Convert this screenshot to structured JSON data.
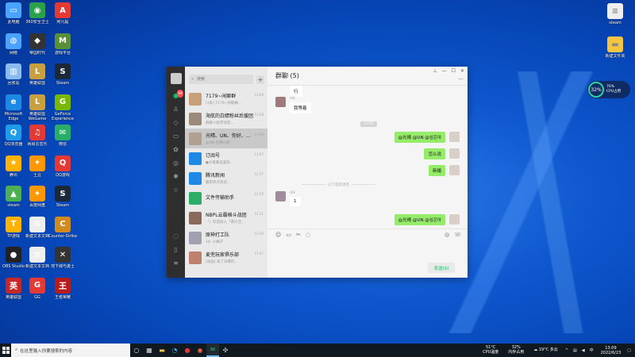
{
  "desktop_icons_left": [
    {
      "label": "此电脑",
      "color": "#4aa3ff",
      "glyph": "▭"
    },
    {
      "label": "360安全卫士",
      "color": "#2aa04a",
      "glyph": "◉"
    },
    {
      "label": "阿凡提",
      "color": "#e53935",
      "glyph": "A"
    },
    {
      "label": "网络",
      "color": "#4aa3ff",
      "glyph": "◍"
    },
    {
      "label": "帝国时代",
      "color": "#333333",
      "glyph": "◆"
    },
    {
      "label": "游戏平台",
      "color": "#5a8f3a",
      "glyph": "M"
    },
    {
      "label": "回收站",
      "color": "#88bbee",
      "glyph": "▥"
    },
    {
      "label": "英雄联盟",
      "color": "#c8a040",
      "glyph": "L"
    },
    {
      "label": "Steam",
      "color": "#1b2838",
      "glyph": "S"
    },
    {
      "label": "Microsoft Edge",
      "color": "#1e88e5",
      "glyph": "e"
    },
    {
      "label": "英雄联盟WeGame",
      "color": "#c8a040",
      "glyph": "L"
    },
    {
      "label": "GeForce Experience",
      "color": "#76b900",
      "glyph": "G"
    },
    {
      "label": "QQ浏览器",
      "color": "#1e9be9",
      "glyph": "Q"
    },
    {
      "label": "网易云音乐",
      "color": "#e53935",
      "glyph": "♫"
    },
    {
      "label": "微信",
      "color": "#2aae67",
      "glyph": "✉"
    },
    {
      "label": "腾讯",
      "color": "#ffb300",
      "glyph": "★"
    },
    {
      "label": "土豆",
      "color": "#ff9800",
      "glyph": "✦"
    },
    {
      "label": "QQ游戏",
      "color": "#e53935",
      "glyph": "Q"
    },
    {
      "label": "steam",
      "color": "#4caf50",
      "glyph": "▲"
    },
    {
      "label": "百度网盘",
      "color": "#ff9800",
      "glyph": "✦"
    },
    {
      "label": "Steam",
      "color": "#1b2838",
      "glyph": "S"
    },
    {
      "label": "TP游戏",
      "color": "#ffb300",
      "glyph": "T"
    },
    {
      "label": "新建文本文档",
      "color": "#eeeeee",
      "glyph": "≡"
    },
    {
      "label": "Counter-Strike",
      "color": "#d08a20",
      "glyph": "C"
    },
    {
      "label": "OBS Studio",
      "color": "#222222",
      "glyph": "●"
    },
    {
      "label": "新建文本文档",
      "color": "#eeeeee",
      "glyph": "≡"
    },
    {
      "label": "地下城与勇士",
      "color": "#333333",
      "glyph": "✕"
    },
    {
      "label": "英雄联盟",
      "color": "#c62828",
      "glyph": "英"
    },
    {
      "label": "GG",
      "color": "#e53935",
      "glyph": "G"
    },
    {
      "label": "王者荣耀",
      "color": "#b71c1c",
      "glyph": "王"
    }
  ],
  "desktop_icons_right": [
    {
      "label": "steam",
      "color": "#eeeeee",
      "glyph": "≡"
    },
    {
      "label": "新建文件夹",
      "color": "#f5c542",
      "glyph": "▬"
    }
  ],
  "widget": {
    "value": "32%",
    "line1": "76%",
    "line2": "CPU占用"
  },
  "wechat": {
    "search_placeholder": "搜索",
    "plus": "+",
    "conversations": [
      {
        "name": "7179~闲聊群",
        "preview": "[1条] 7179~闲聊群...",
        "time": "13:09",
        "color": "#c7a07a",
        "selected": false
      },
      {
        "name": "海航的白嫖粉丝后援团",
        "preview": "群聊小程序消息...",
        "time": "13:08",
        "color": "#9b8a7a",
        "selected": false
      },
      {
        "name": "光晴、UN、你好、...",
        "preview": "@UN 在哪儿呢",
        "time": "13:08",
        "color": "#b0a090",
        "selected": true
      },
      {
        "name": "订阅号",
        "preview": "●大家都说喜欢...",
        "time": "13:07",
        "color": "#1e88e5",
        "selected": false
      },
      {
        "name": "腾讯新闻",
        "preview": "最新热点资讯...",
        "time": "12:57",
        "color": "#1e88e5",
        "selected": false
      },
      {
        "name": "文件传输助手",
        "preview": "",
        "time": "12:50",
        "color": "#2aae67",
        "selected": false
      },
      {
        "name": "NBPL云霸格斗战团",
        "preview": "「」欢迎加入「黄沙活...",
        "time": "12:31",
        "color": "#8a6a5a",
        "selected": false
      },
      {
        "name": "原神打工队",
        "preview": "14: 小橘子",
        "time": "12:00",
        "color": "#a0a0b0",
        "selected": false
      },
      {
        "name": "麦兜玩家俱乐部",
        "preview": "[动画] 拿了白嫖的...",
        "time": "11:47",
        "color": "#c08070",
        "selected": false
      }
    ],
    "chat_title": "群聊 (5)",
    "messages": [
      {
        "side": "left",
        "sender": "",
        "text": "行"
      },
      {
        "side": "left",
        "sender": "UN",
        "text": "我等着"
      },
      {
        "side": "right",
        "sender": "",
        "text": "@光晴 @UN @심은아"
      },
      {
        "side": "right",
        "sender": "",
        "text": "怎么说"
      },
      {
        "side": "right",
        "sender": "",
        "text": "新婚"
      },
      {
        "side": "left",
        "sender": "UN",
        "text": "1"
      },
      {
        "side": "right",
        "sender": "",
        "text": "@光晴 @UN @심은아"
      }
    ],
    "timestamp": "13:07",
    "divider": "以下是新消息",
    "send_label": "发送(S)",
    "window_controls": [
      "⊥",
      "—",
      "☐",
      "✕"
    ]
  },
  "taskbar": {
    "search_placeholder": "在这里输入你要搜索的内容",
    "cpu_temp": "51°C",
    "cpu_label": "CPU温度",
    "mem": "32%",
    "mem_label": "内存占用",
    "weather": "19°C 多云",
    "time": "13:09",
    "date": "2022/6/23"
  }
}
